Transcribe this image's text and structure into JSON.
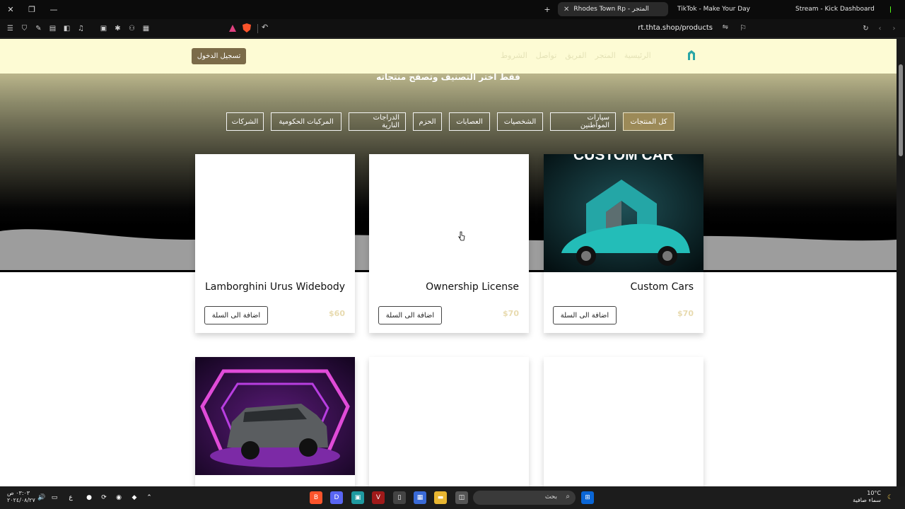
{
  "browser": {
    "tabs": [
      {
        "label": "Rhodes Town Rp - المتجر",
        "active": true
      },
      {
        "label": "TikTok - Make Your Day",
        "active": false
      },
      {
        "label": "Stream - Kick Dashboard",
        "active": false
      }
    ],
    "url": "rt.thta.shop/products"
  },
  "header": {
    "login_label": "تسجيل الدخول",
    "nav_links": [
      "الرئيسية",
      "المتجر",
      "الفريق",
      "تواصل",
      "الشروط"
    ]
  },
  "hero": {
    "subtitle": "فقط اختر التصنيف وتصفح منتجاته"
  },
  "categories": [
    {
      "label": "كل المنتجات",
      "active": true
    },
    {
      "label": "سيارات المواطنين",
      "active": false
    },
    {
      "label": "الشخصيات",
      "active": false
    },
    {
      "label": "العصابات",
      "active": false
    },
    {
      "label": "الحزم",
      "active": false
    },
    {
      "label": "الدراجات النارية",
      "active": false
    },
    {
      "label": "المركبات الحكومية",
      "active": false
    },
    {
      "label": "الشركات",
      "active": false
    }
  ],
  "products": [
    {
      "title": "Custom Cars",
      "price": "$70",
      "cart_label": "اضافة الى السلة",
      "image_text": "CUSTOM CAR"
    },
    {
      "title": "Ownership License",
      "price": "$70",
      "cart_label": "اضافة الى السلة"
    },
    {
      "title": "Lamborghini Urus Widebody",
      "price": "$60",
      "cart_label": "اضافة الى السلة"
    }
  ],
  "taskbar": {
    "search_placeholder": "بحث",
    "weather_temp": "10°C",
    "weather_desc": "سماء صافية",
    "time": "٠٣:٠٣ ص",
    "date": "٢٠٢٤/٠٨/٢٧",
    "lang": "ع"
  },
  "colors": {
    "accent": "#9c8a58",
    "login_bg": "#7b6b49",
    "header_bg": "#fdfbd4"
  }
}
